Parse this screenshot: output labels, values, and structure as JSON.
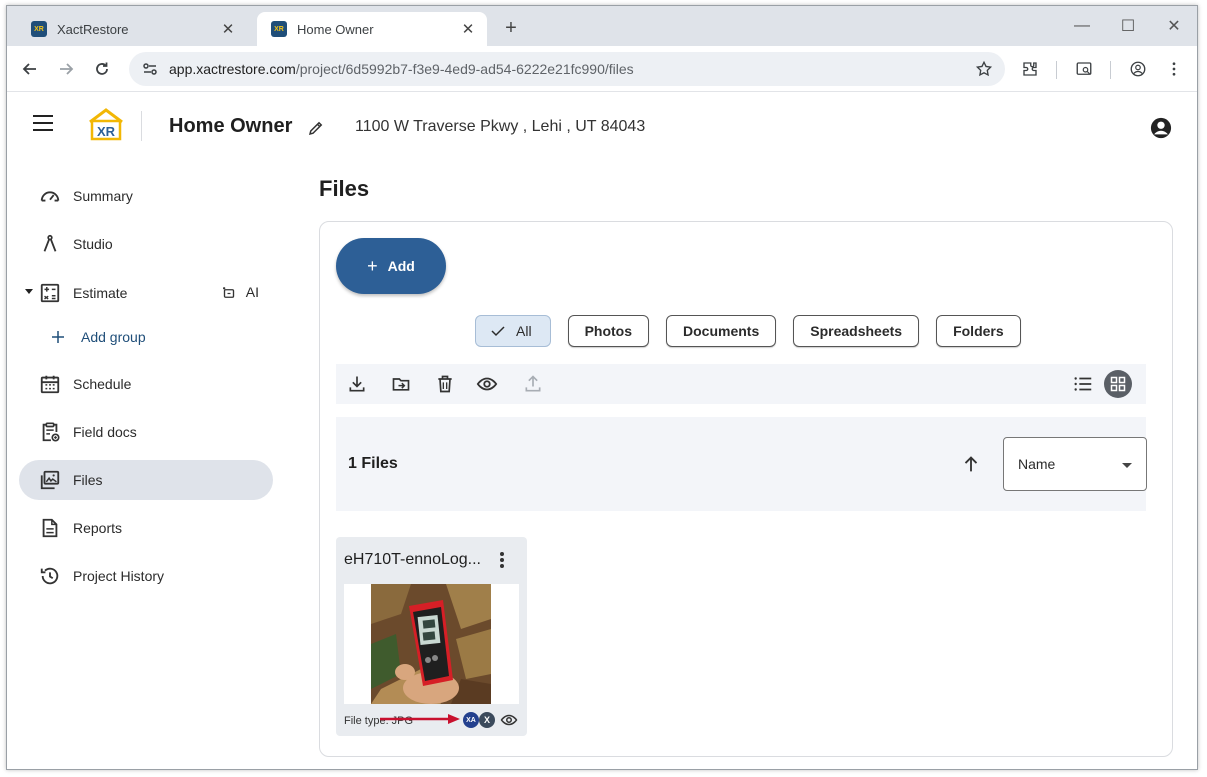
{
  "browser": {
    "tabs": [
      {
        "title": "XactRestore",
        "active": false,
        "favicon": "xr-favicon"
      },
      {
        "title": "Home Owner",
        "active": true,
        "favicon": "xr-favicon"
      }
    ],
    "new_tab": "+",
    "window_controls": {
      "minimize": "—",
      "maximize": "☐",
      "close": "✕"
    },
    "close_tab": "✕",
    "url_host": "app.xactrestore.com",
    "url_path": "/project/6d5992b7-f3e9-4ed9-ad54-6222e21fc990/files"
  },
  "header": {
    "logo_text": "XR",
    "project_title": "Home Owner",
    "address": "1100 W Traverse Pkwy , Lehi , UT 84043"
  },
  "sidebar": {
    "items": [
      {
        "label": "Summary",
        "icon": "speedometer-icon"
      },
      {
        "label": "Studio",
        "icon": "compass-icon"
      },
      {
        "label": "Estimate",
        "icon": "calculator-icon",
        "ai_label": "AI"
      },
      {
        "label": "Add group",
        "icon": "plus-icon"
      },
      {
        "label": "Schedule",
        "icon": "calendar-icon"
      },
      {
        "label": "Field docs",
        "icon": "field-docs-icon"
      },
      {
        "label": "Files",
        "icon": "photo-library-icon",
        "active": true
      },
      {
        "label": "Reports",
        "icon": "document-icon"
      },
      {
        "label": "Project History",
        "icon": "history-icon"
      }
    ]
  },
  "main": {
    "title": "Files",
    "add_label": "Add",
    "filters": [
      {
        "label": "All",
        "selected": true
      },
      {
        "label": "Photos"
      },
      {
        "label": "Documents"
      },
      {
        "label": "Spreadsheets"
      },
      {
        "label": "Folders"
      }
    ],
    "file_count": "1 Files",
    "sort_field": "Name",
    "files": [
      {
        "name": "eH710T-ennoLog...",
        "type_text": "File type: JPG",
        "badge_xa": "XA",
        "badge_x": "X"
      }
    ]
  },
  "colors": {
    "accent": "#2d5f96",
    "chip_selected": "#dde8f4",
    "sidebar_active": "#dfe3ea",
    "annotation_arrow": "#c8102e"
  }
}
